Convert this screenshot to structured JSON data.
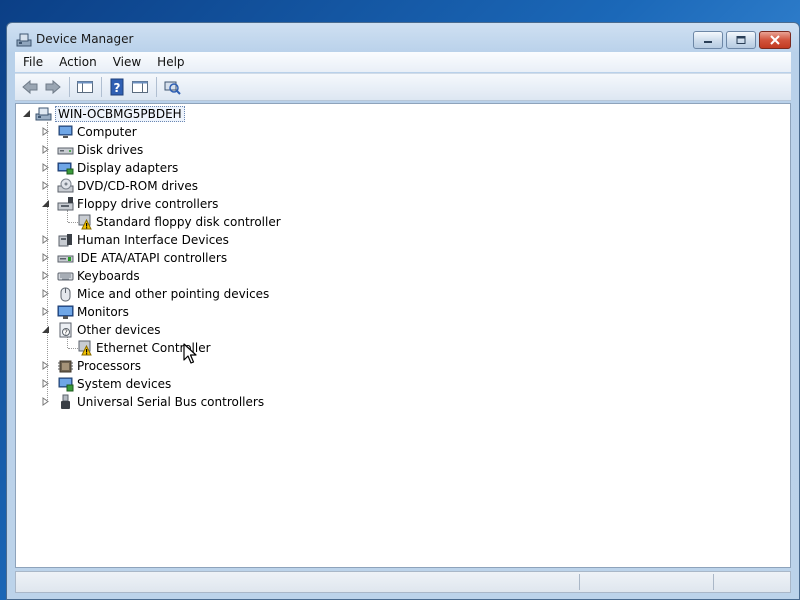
{
  "window": {
    "title": "Device Manager",
    "controls": [
      "minimize",
      "maximize",
      "close"
    ]
  },
  "menu": {
    "items": [
      "File",
      "Action",
      "View",
      "Help"
    ]
  },
  "toolbar": {
    "icons": [
      "back-arrow-icon",
      "forward-arrow-icon",
      "show-hide-console-tree-icon",
      "help-icon",
      "properties-pane-icon",
      "scan-hardware-changes-icon"
    ]
  },
  "tree": {
    "root": {
      "label": "WIN-OCBMG5PBDEH",
      "expanded": true
    },
    "categories": [
      {
        "label": "Computer",
        "icon": "computer-icon",
        "expanded": false
      },
      {
        "label": "Disk drives",
        "icon": "disk-drive-icon",
        "expanded": false
      },
      {
        "label": "Display adapters",
        "icon": "display-adapter-icon",
        "expanded": false
      },
      {
        "label": "DVD/CD-ROM drives",
        "icon": "dvd-drive-icon",
        "expanded": false
      },
      {
        "label": "Floppy drive controllers",
        "icon": "floppy-controller-icon",
        "expanded": true
      },
      {
        "label": "Human Interface Devices",
        "icon": "hid-icon",
        "expanded": false
      },
      {
        "label": "IDE ATA/ATAPI controllers",
        "icon": "ide-controller-icon",
        "expanded": false
      },
      {
        "label": "Keyboards",
        "icon": "keyboard-icon",
        "expanded": false
      },
      {
        "label": "Mice and other pointing devices",
        "icon": "mouse-icon",
        "expanded": false
      },
      {
        "label": "Monitors",
        "icon": "monitor-icon",
        "expanded": false
      },
      {
        "label": "Other devices",
        "icon": "other-devices-icon",
        "expanded": true
      },
      {
        "label": "Processors",
        "icon": "processor-icon",
        "expanded": false
      },
      {
        "label": "System devices",
        "icon": "system-devices-icon",
        "expanded": false
      },
      {
        "label": "Universal Serial Bus controllers",
        "icon": "usb-icon",
        "expanded": false
      }
    ],
    "children": {
      "floppy": {
        "label": "Standard floppy disk controller",
        "icon": "warning-device-icon"
      },
      "other": {
        "label": "Ethernet Controller",
        "icon": "warning-device-icon"
      }
    }
  },
  "colors": {
    "accent": "#1b68b8",
    "close_button": "#c23a22",
    "warning": "#f5c400"
  }
}
